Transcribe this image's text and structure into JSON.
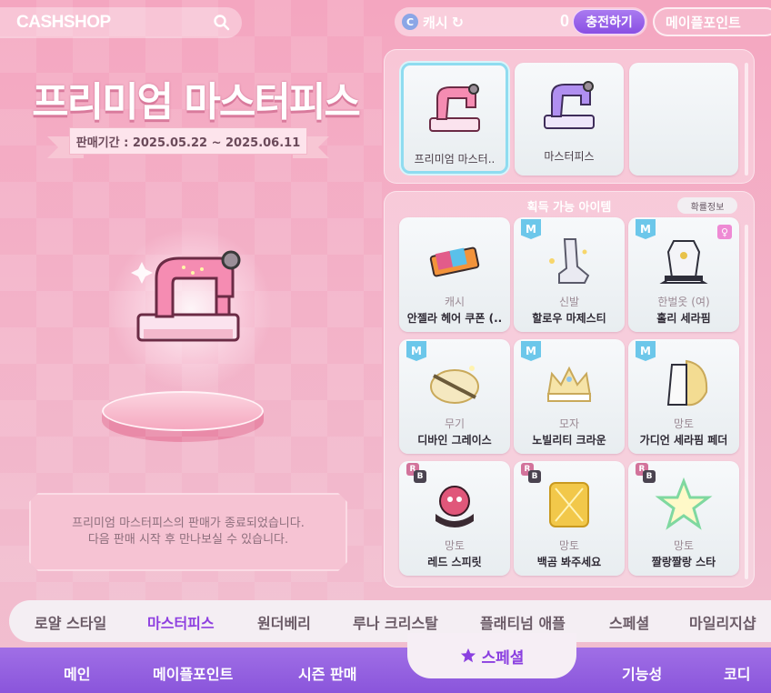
{
  "topbar": {
    "brand": "CASHSHOP",
    "cash_label": "캐시",
    "cash_amount": "0",
    "charge_label": "충전하기",
    "maple_points_label": "메이플포인트"
  },
  "hero": {
    "title": "프리미엄 마스터피스",
    "sale_period": "판매기간 : 2025.05.22 ~ 2025.06.11",
    "notice_line1": "프리미엄 마스터피스의 판매가 종료되었습니다.",
    "notice_line2": "다음 판매 시작 후 만나보실 수 있습니다."
  },
  "selector": {
    "cards": [
      {
        "name": "프리미엄 마스터..",
        "selected": true
      },
      {
        "name": "마스터피스",
        "selected": false
      },
      {
        "name": "",
        "selected": false
      }
    ]
  },
  "obtainable": {
    "title": "획득 가능 아이템",
    "prob_label": "확률정보",
    "items": [
      {
        "category": "캐시",
        "name": "안젤라 헤어 쿠폰 (..",
        "badge": "",
        "icon": "hair-coupon-icon"
      },
      {
        "category": "신발",
        "name": "할로우 마제스티",
        "badge": "M",
        "icon": "shoe-icon"
      },
      {
        "category": "한벌옷 (여)",
        "name": "홀리 세라핌",
        "badge": "M",
        "icon": "outfit-icon",
        "female": "♀"
      },
      {
        "category": "무기",
        "name": "디바인 그레이스",
        "badge": "M",
        "icon": "weapon-icon"
      },
      {
        "category": "모자",
        "name": "노빌리티 크라운",
        "badge": "M",
        "icon": "crown-icon"
      },
      {
        "category": "망토",
        "name": "가디언 세라핌 페더",
        "badge": "M",
        "icon": "cape-icon"
      },
      {
        "category": "망토",
        "name": "레드 스피릿",
        "badge": "RB",
        "icon": "cape-icon"
      },
      {
        "category": "망토",
        "name": "백곰 봐주세요",
        "badge": "RB",
        "icon": "cape-icon"
      },
      {
        "category": "망토",
        "name": "짤랑짤랑 스타",
        "badge": "RB",
        "icon": "star-cape-icon"
      }
    ]
  },
  "category_tabs": [
    "로얄 스타일",
    "마스터피스",
    "원더베리",
    "루나 크리스탈",
    "플래티넘 애플",
    "스페셜",
    "마일리지샵"
  ],
  "active_category": "마스터피스",
  "bottom_nav": {
    "main": "메인",
    "maple_points": "메이플포인트",
    "season": "시즌 판매",
    "special": "스페셜",
    "features": "기능성",
    "codi": "코디"
  },
  "colors": {
    "accent_purple": "#8e3fe0",
    "pink_bg": "#f4a6c0",
    "selected_border": "#8fdcf0"
  }
}
